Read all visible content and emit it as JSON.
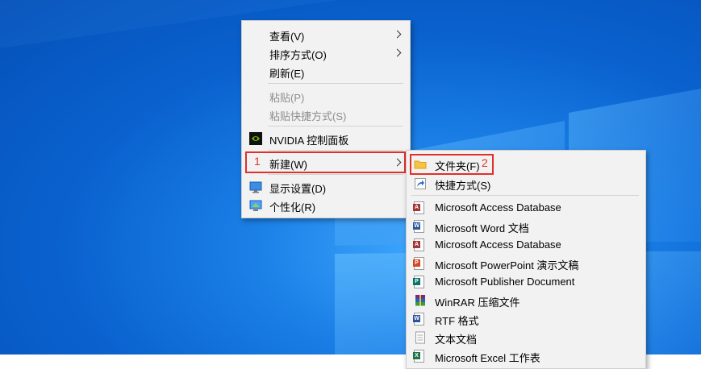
{
  "context_menu": {
    "items": [
      {
        "label": "查看(V)",
        "submenu": true
      },
      {
        "label": "排序方式(O)",
        "submenu": true
      },
      {
        "label": "刷新(E)"
      },
      {
        "label": "粘贴(P)",
        "disabled": true
      },
      {
        "label": "粘贴快捷方式(S)",
        "disabled": true
      },
      {
        "label": "NVIDIA 控制面板",
        "icon": "nvidia-icon"
      },
      {
        "label": "新建(W)",
        "submenu": true,
        "highlighted": true
      },
      {
        "label": "显示设置(D)",
        "icon": "display-settings-icon"
      },
      {
        "label": "个性化(R)",
        "icon": "personalize-icon"
      }
    ]
  },
  "new_submenu": {
    "items": [
      {
        "label": "文件夹(F)",
        "icon": "folder-icon",
        "highlighted": true
      },
      {
        "label": "快捷方式(S)",
        "icon": "shortcut-icon"
      },
      {
        "label": "Microsoft Access Database",
        "icon": "access-icon",
        "color": "#a4373a"
      },
      {
        "label": "Microsoft Word 文档",
        "icon": "word-icon",
        "color": "#2b579a"
      },
      {
        "label": "Microsoft Access Database",
        "icon": "access-icon",
        "color": "#a4373a"
      },
      {
        "label": "Microsoft PowerPoint 演示文稿",
        "icon": "powerpoint-icon",
        "color": "#d24726"
      },
      {
        "label": "Microsoft Publisher Document",
        "icon": "publisher-icon",
        "color": "#077568"
      },
      {
        "label": "WinRAR 压缩文件",
        "icon": "winrar-icon",
        "color": "#7a2a7a"
      },
      {
        "label": "RTF 格式",
        "icon": "rtf-icon",
        "color": "#2b579a"
      },
      {
        "label": "文本文档",
        "icon": "text-file-icon"
      },
      {
        "label": "Microsoft Excel 工作表",
        "icon": "excel-icon",
        "color": "#217346"
      }
    ]
  },
  "annotations": {
    "step1": "1",
    "step2": "2"
  },
  "colors": {
    "desktop": "#0a62cf",
    "highlight": "#e0302a",
    "menu_bg": "#f2f2f2"
  }
}
